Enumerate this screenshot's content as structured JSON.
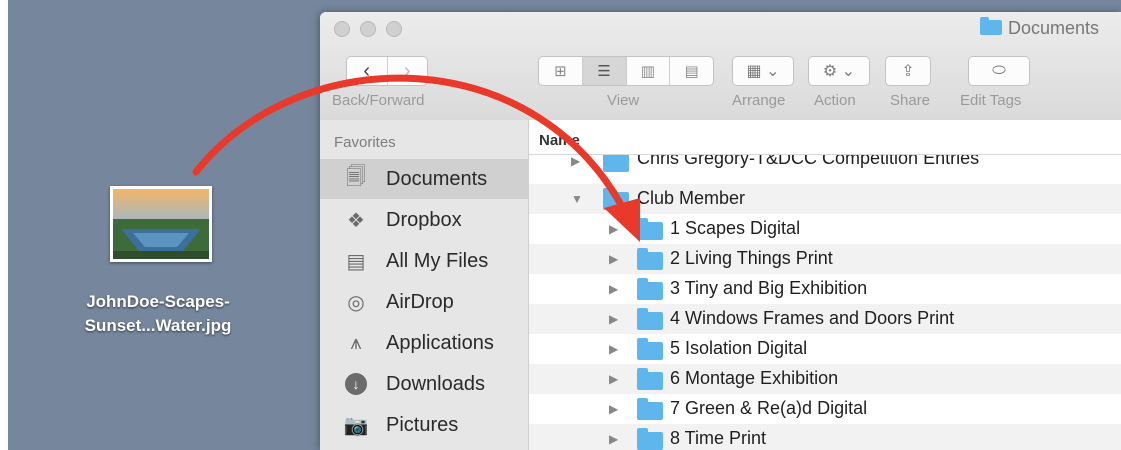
{
  "desktop": {
    "file": {
      "name_line1": "JohnDoe-Scapes-",
      "name_line2": "Sunset...Water.jpg"
    }
  },
  "window": {
    "title": "Documents",
    "toolbar": {
      "back_forward_label": "Back/Forward",
      "view_label": "View",
      "arrange_label": "Arrange",
      "action_label": "Action",
      "share_label": "Share",
      "edit_tags_label": "Edit Tags"
    },
    "sidebar": {
      "heading": "Favorites",
      "items": [
        {
          "label": "Documents",
          "icon": "documents-icon",
          "selected": true
        },
        {
          "label": "Dropbox",
          "icon": "dropbox-icon"
        },
        {
          "label": "All My Files",
          "icon": "all-files-icon"
        },
        {
          "label": "AirDrop",
          "icon": "airdrop-icon"
        },
        {
          "label": "Applications",
          "icon": "applications-icon"
        },
        {
          "label": "Downloads",
          "icon": "downloads-icon"
        },
        {
          "label": "Pictures",
          "icon": "pictures-icon"
        }
      ]
    },
    "list": {
      "column_name": "Name",
      "rows": [
        {
          "label": "Chris Gregory-T&DCC Competition Entries",
          "expanded": false,
          "level": 0
        },
        {
          "label": "Club Member",
          "expanded": true,
          "level": 0
        },
        {
          "label": "1 Scapes Digital",
          "expanded": false,
          "level": 1
        },
        {
          "label": "2 Living Things Print",
          "expanded": false,
          "level": 1
        },
        {
          "label": "3 Tiny and Big Exhibition",
          "expanded": false,
          "level": 1
        },
        {
          "label": "4 Windows Frames and Doors Print",
          "expanded": false,
          "level": 1
        },
        {
          "label": "5 Isolation Digital",
          "expanded": false,
          "level": 1
        },
        {
          "label": "6 Montage Exhibition",
          "expanded": false,
          "level": 1
        },
        {
          "label": "7 Green & Re(a)d Digital",
          "expanded": false,
          "level": 1
        },
        {
          "label": "8 Time Print",
          "expanded": false,
          "level": 1
        }
      ]
    }
  },
  "colors": {
    "desktop": "#76869d",
    "folder": "#5fb6ec",
    "arrow": "#e8392b"
  }
}
